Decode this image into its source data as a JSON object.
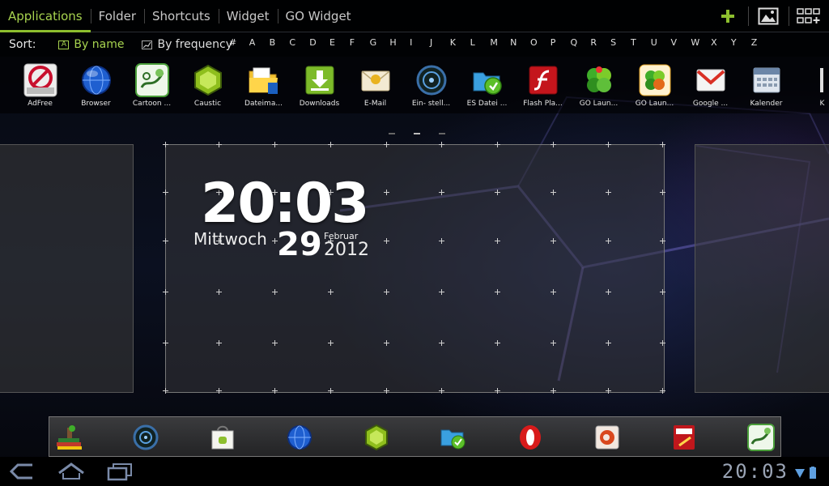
{
  "tabs": [
    {
      "label": "Applications",
      "active": true
    },
    {
      "label": "Folder",
      "active": false
    },
    {
      "label": "Shortcuts",
      "active": false
    },
    {
      "label": "Widget",
      "active": false
    },
    {
      "label": "GO Widget",
      "active": false
    }
  ],
  "tab_actions": [
    "add-icon",
    "wallpaper-icon",
    "add-screen-icon"
  ],
  "sort": {
    "label": "Sort:",
    "by_name": "By name",
    "by_name_box": "A",
    "by_frequency": "By frequency",
    "alphabet": [
      "#",
      "A",
      "B",
      "C",
      "D",
      "E",
      "F",
      "G",
      "H",
      "I",
      "J",
      "K",
      "L",
      "M",
      "N",
      "O",
      "P",
      "Q",
      "R",
      "S",
      "T",
      "U",
      "V",
      "W",
      "X",
      "Y",
      "Z"
    ]
  },
  "apps": [
    {
      "label": "AdFree",
      "icon": "adfree-icon"
    },
    {
      "label": "Browser",
      "icon": "browser-icon"
    },
    {
      "label": "Cartoon ...",
      "icon": "cartoon-icon"
    },
    {
      "label": "Caustic",
      "icon": "caustic-icon"
    },
    {
      "label": "Dateima...",
      "icon": "file-manager-icon"
    },
    {
      "label": "Downloads",
      "icon": "downloads-icon"
    },
    {
      "label": "E-Mail",
      "icon": "email-icon"
    },
    {
      "label": "Ein- stell...",
      "icon": "settings-icon"
    },
    {
      "label": "ES Datei ...",
      "icon": "es-file-icon"
    },
    {
      "label": "Flash Pla...",
      "icon": "flash-icon"
    },
    {
      "label": "GO Laun...",
      "icon": "go-launcher-icon"
    },
    {
      "label": "GO Laun...",
      "icon": "go-launcher-theme-icon"
    },
    {
      "label": "Google ...",
      "icon": "gmail-icon"
    },
    {
      "label": "Kalender",
      "icon": "calendar-icon"
    },
    {
      "label": "K",
      "icon": "partial-app-icon"
    }
  ],
  "clock": {
    "time": "20:03",
    "weekday": "Mittwoch",
    "day": "29",
    "month": "Februar",
    "year": "2012"
  },
  "dock": [
    "books-icon",
    "orb-icon",
    "market-icon",
    "browser-icon",
    "caustic-icon",
    "es-file-icon",
    "opera-icon",
    "amazon-icon",
    "pdf-icon",
    "cartoon-icon"
  ],
  "system": {
    "time": "20:03",
    "nav": [
      "back-icon",
      "home-icon",
      "recent-apps-icon"
    ]
  },
  "colors": {
    "accent": "#8dbf2e",
    "accent_text": "#a7d34f"
  }
}
